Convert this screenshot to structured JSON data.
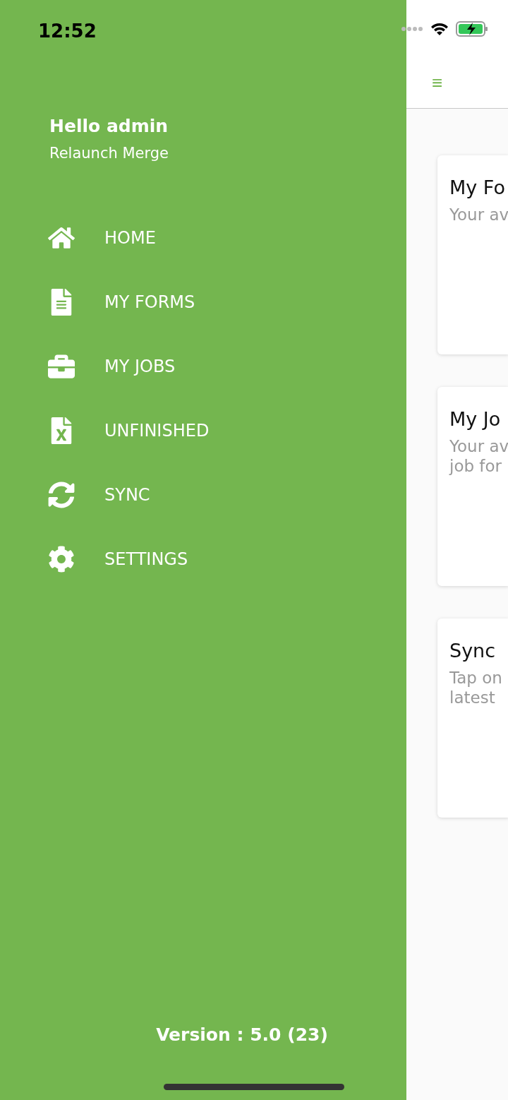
{
  "status_bar": {
    "time": "12:52"
  },
  "drawer": {
    "greeting": "Hello admin",
    "subtitle": "Relaunch Merge",
    "items": [
      {
        "kind": "home",
        "label": "HOME"
      },
      {
        "kind": "form",
        "label": "MY FORMS"
      },
      {
        "kind": "jobs",
        "label": "MY JOBS"
      },
      {
        "kind": "unfinished",
        "label": "UNFINISHED"
      },
      {
        "kind": "sync",
        "label": "SYNC"
      },
      {
        "kind": "settings",
        "label": "SETTINGS"
      }
    ],
    "version": "Version : 5.0 (23)"
  },
  "content": {
    "menu_icon": "≡",
    "cards": [
      {
        "title": "My Fo",
        "lines": [
          "Your av"
        ]
      },
      {
        "title": "My Jo",
        "lines": [
          "Your av",
          "job for"
        ]
      },
      {
        "title": "Sync",
        "lines": [
          "Tap on",
          "latest"
        ]
      }
    ]
  }
}
